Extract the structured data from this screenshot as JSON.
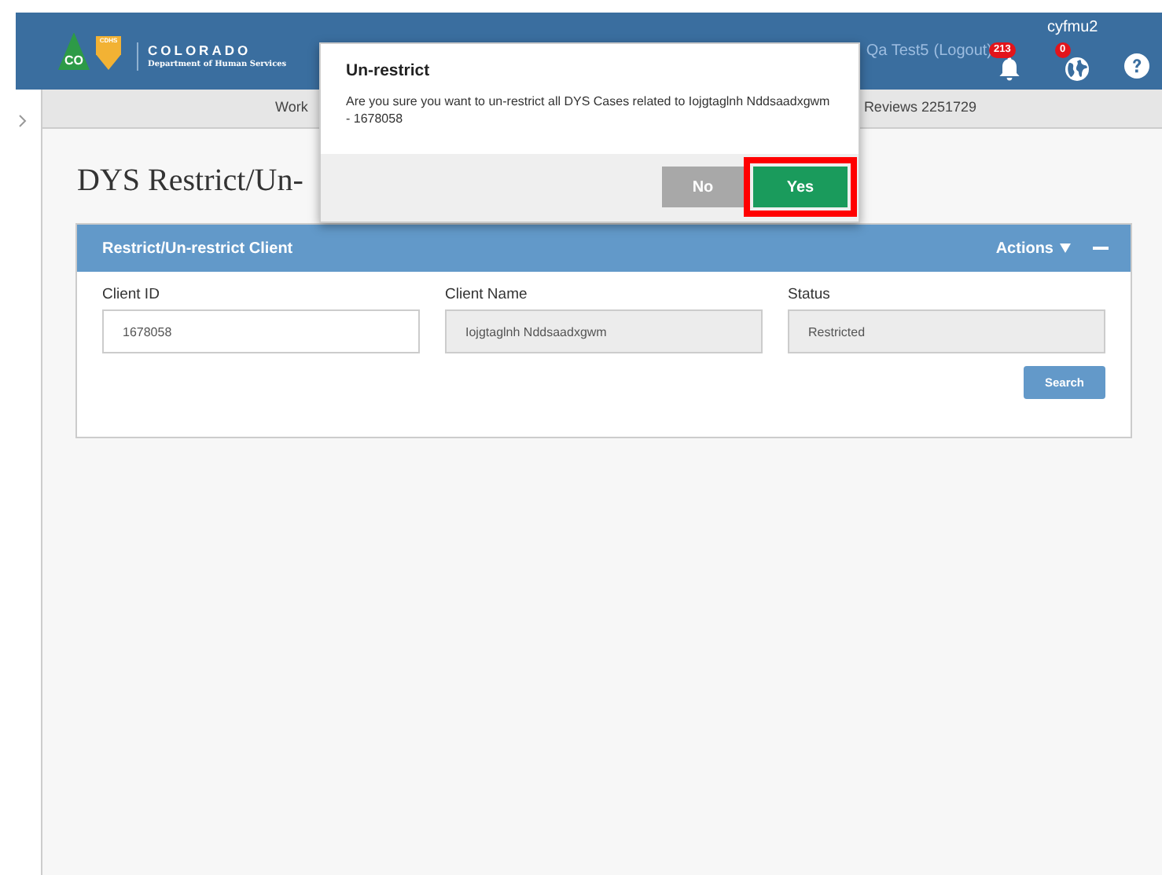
{
  "header": {
    "logo": {
      "mark_text": "CO",
      "shield_text": "CDHS",
      "name": "COLORADO",
      "subtitle": "Department of Human Services"
    },
    "user_text": "Qa Test5",
    "logout": "(Logout)",
    "username": "cyfmu2",
    "notifications": [
      {
        "kind": "bell",
        "count": "213"
      },
      {
        "kind": "globe",
        "count": "0"
      }
    ]
  },
  "subnav": [
    "Work",
    "Reviews 2251729"
  ],
  "page_title": "DYS Restrict/Un-",
  "panel": {
    "title": "Restrict/Un-restrict Client",
    "actions": "Actions",
    "fields": [
      {
        "label": "Client ID",
        "value": "1678058",
        "disabled": false
      },
      {
        "label": "Client Name",
        "value": "Iojgtaglnh Nddsaadxgwm",
        "disabled": true
      },
      {
        "label": "Status",
        "value": "Restricted",
        "disabled": true
      }
    ],
    "button": "Search"
  },
  "modal": {
    "title": "Un-restrict",
    "message": "Are you sure you want to un-restrict all DYS Cases related to Iojgtaglnh Nddsaadxgwm - 1678058",
    "buttons": [
      {
        "label": "No",
        "kind": "secondary",
        "highlighted": false
      },
      {
        "label": "Yes",
        "kind": "primary",
        "highlighted": true
      }
    ]
  }
}
